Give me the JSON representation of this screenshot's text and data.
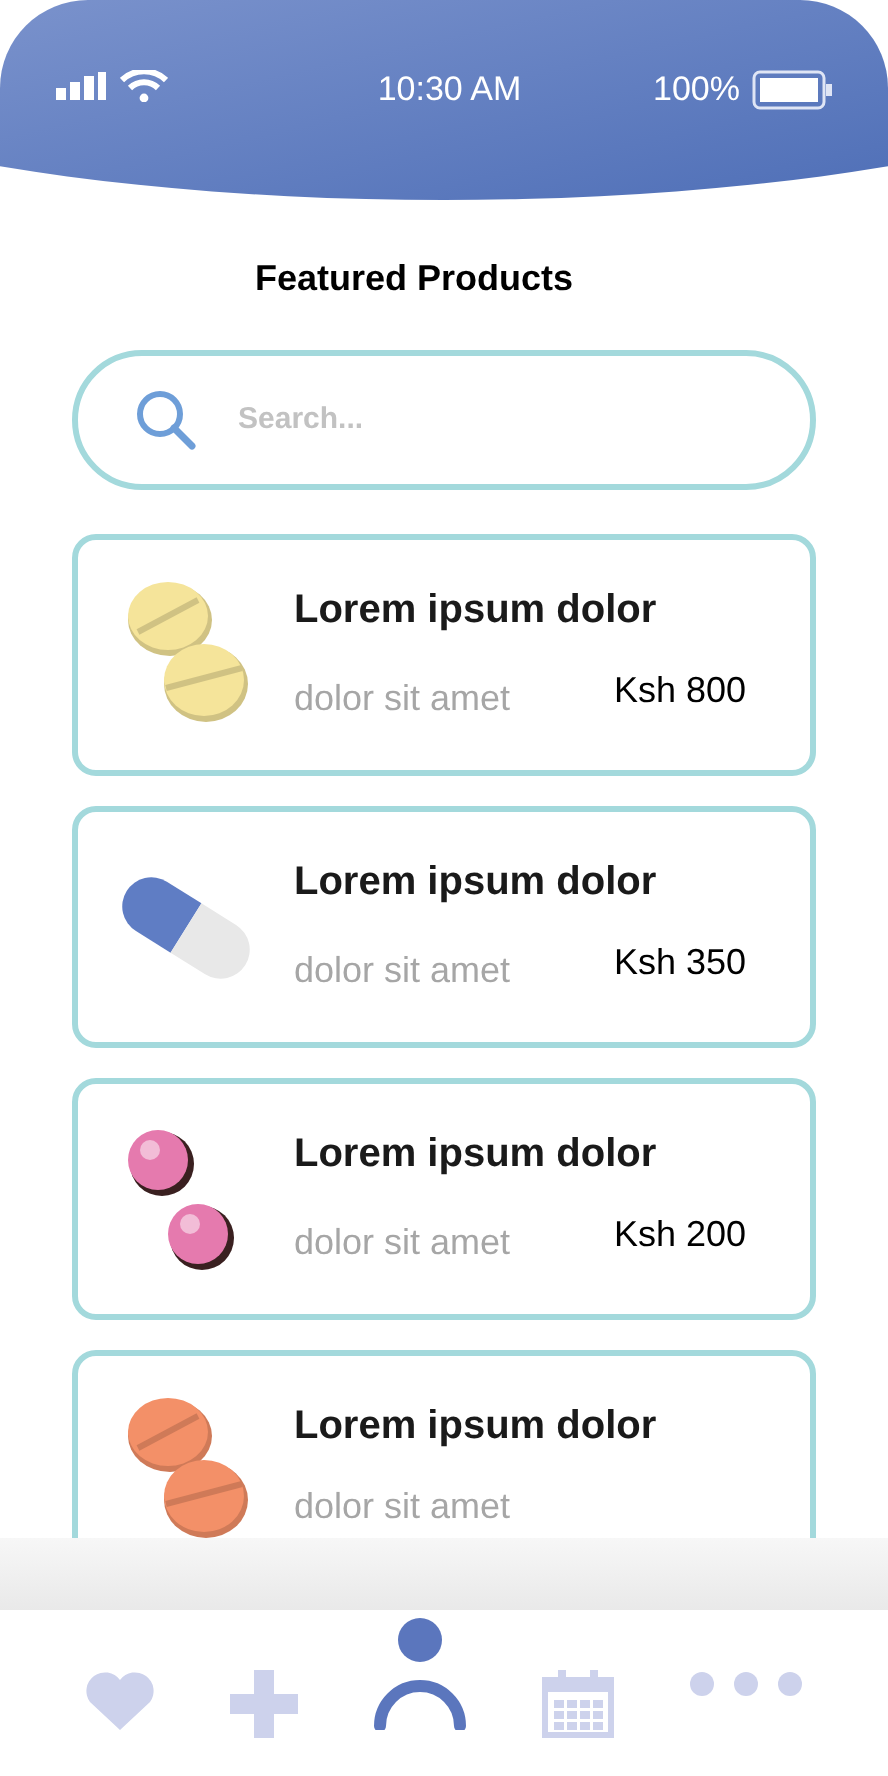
{
  "status_bar": {
    "time": "10:30 AM",
    "battery": "100%"
  },
  "title": "Featured Products",
  "search": {
    "placeholder": "Search..."
  },
  "products": [
    {
      "kind": "tablets",
      "color": "#f5e49a",
      "name": "Lorem ipsum dolor",
      "subtitle": "dolor sit amet",
      "price": "Ksh 800"
    },
    {
      "kind": "capsule",
      "color": "#5f7dc4",
      "name": "Lorem ipsum dolor",
      "subtitle": "dolor sit amet",
      "price": "Ksh 350"
    },
    {
      "kind": "pills",
      "color": "#e57aae",
      "name": "Lorem ipsum dolor",
      "subtitle": "dolor sit amet",
      "price": "Ksh 200"
    },
    {
      "kind": "tablets",
      "color": "#f39068",
      "name": "Lorem ipsum dolor",
      "subtitle": "dolor sit amet"
    }
  ],
  "nav": [
    {
      "kind": "heart",
      "selected": false
    },
    {
      "kind": "plus",
      "selected": false
    },
    {
      "kind": "person",
      "selected": true
    },
    {
      "kind": "calendar",
      "selected": false
    },
    {
      "kind": "more",
      "selected": false
    }
  ]
}
